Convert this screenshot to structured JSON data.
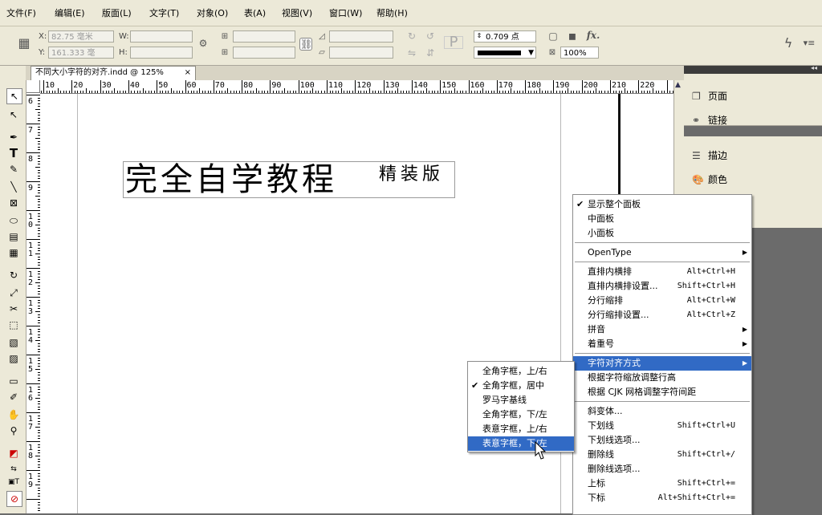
{
  "menubar": {
    "items": [
      "文件(F)",
      "编辑(E)",
      "版面(L)",
      "文字(T)",
      "对象(O)",
      "表(A)",
      "视图(V)",
      "窗口(W)",
      "帮助(H)"
    ]
  },
  "control": {
    "x_label": "X:",
    "x_value": "82.75 毫米",
    "y_label": "Y:",
    "y_value": "161.333 毫",
    "w_label": "W:",
    "h_label": "H:",
    "stroke_value": "0.709 点",
    "zoom_value": "100%",
    "fx_label": "fx."
  },
  "document": {
    "tab_title": "不同大小字符的对齐.indd @ 125%",
    "close_glyph": "×",
    "main_text": "完全自学教程",
    "sub_text": "精装版"
  },
  "hruler": {
    "labels": [
      "10",
      "20",
      "30",
      "40",
      "50",
      "60",
      "70",
      "80",
      "90",
      "100",
      "110",
      "120",
      "130",
      "140",
      "150",
      "160",
      "170",
      "180",
      "190",
      "200",
      "210",
      "220"
    ]
  },
  "vruler": {
    "labels": [
      "6",
      "7",
      "8",
      "9",
      "10",
      "11",
      "12",
      "13",
      "14",
      "15",
      "16",
      "17",
      "18",
      "19"
    ]
  },
  "right_panels": {
    "items": [
      {
        "label": "页面",
        "icon": "pages-icon"
      },
      {
        "label": "链接",
        "icon": "links-icon"
      },
      {
        "label": "描边",
        "icon": "stroke-icon"
      },
      {
        "label": "颜色",
        "icon": "color-icon"
      }
    ]
  },
  "panel_menu": {
    "items": [
      {
        "label": "显示整个面板",
        "checked": true
      },
      {
        "label": "中面板"
      },
      {
        "label": "小面板"
      },
      {
        "label": "OpenType",
        "submenu": true
      },
      {
        "label": "直排内横排",
        "shortcut": "Alt+Ctrl+H"
      },
      {
        "label": "直排内横排设置...",
        "shortcut": "Shift+Ctrl+H"
      },
      {
        "label": "分行缩排",
        "shortcut": "Alt+Ctrl+W"
      },
      {
        "label": "分行缩排设置...",
        "shortcut": "Alt+Ctrl+Z"
      },
      {
        "label": "拼音",
        "submenu": true
      },
      {
        "label": "着重号",
        "submenu": true
      },
      {
        "label": "字符对齐方式",
        "submenu": true,
        "highlighted": true
      },
      {
        "label": "根据字符缩放调整行高"
      },
      {
        "label": "根据 CJK 网格调整字符间距"
      },
      {
        "label": "斜变体..."
      },
      {
        "label": "下划线",
        "shortcut": "Shift+Ctrl+U"
      },
      {
        "label": "下划线选项..."
      },
      {
        "label": "删除线",
        "shortcut": "Shift+Ctrl+/"
      },
      {
        "label": "删除线选项..."
      },
      {
        "label": "上标",
        "shortcut": "Shift+Ctrl+="
      },
      {
        "label": "下标",
        "shortcut": "Alt+Shift+Ctrl+="
      }
    ]
  },
  "submenu": {
    "items": [
      {
        "label": "全角字框，上/右"
      },
      {
        "label": "全角字框，居中",
        "checked": true
      },
      {
        "label": "罗马字基线"
      },
      {
        "label": "全角字框，下/左"
      },
      {
        "label": "表意字框，上/右"
      },
      {
        "label": "表意字框，下/左",
        "highlighted": true
      }
    ]
  },
  "colors": {
    "highlight": "#316ac5",
    "chrome": "#ece9d8",
    "panel_bg": "#6b6b6b"
  }
}
